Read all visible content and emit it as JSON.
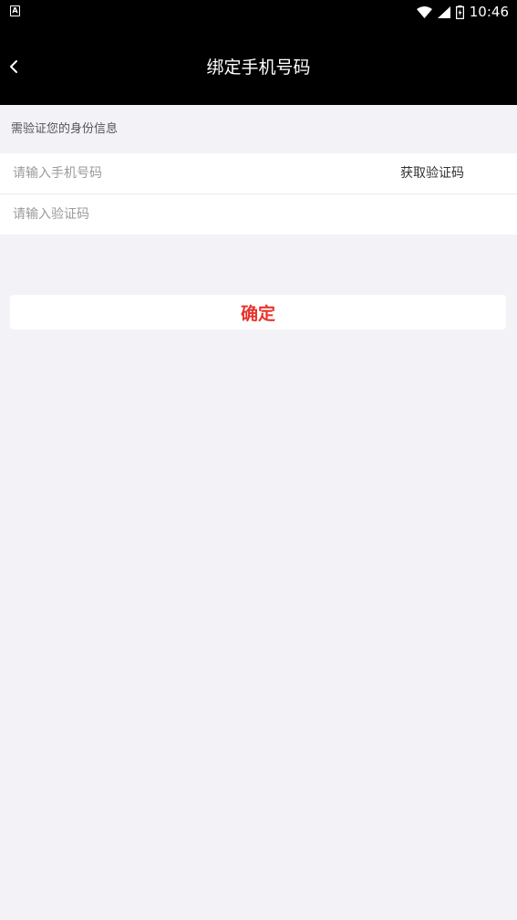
{
  "status_bar": {
    "app_icon": "A",
    "time": "10:46",
    "icons": [
      "wifi-icon",
      "signal-icon",
      "battery-icon"
    ]
  },
  "nav": {
    "title": "绑定手机号码",
    "back_icon": "chevron-left-icon"
  },
  "form": {
    "hint": "需验证您的身份信息",
    "phone_placeholder": "请输入手机号码",
    "phone_value": "",
    "get_code_label": "获取验证码",
    "code_placeholder": "请输入验证码",
    "code_value": ""
  },
  "confirm_label": "确定",
  "colors": {
    "navbar": "#000000",
    "background": "#f2f2f7",
    "accent": "#e8352e"
  }
}
